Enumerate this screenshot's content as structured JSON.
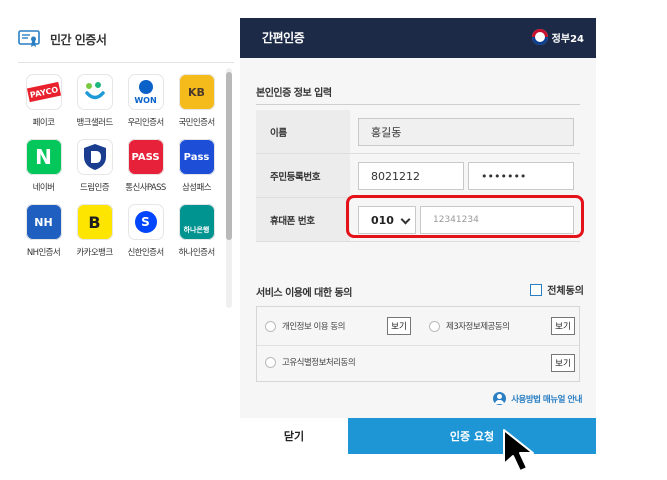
{
  "left_panel": {
    "title": "민간 인증서",
    "apps": [
      {
        "label": "페이코",
        "badge": "PAYCO",
        "bg": "#ffffff",
        "fg": "#ffffff",
        "accent": "#e8212c"
      },
      {
        "label": "뱅크샐러드",
        "badge": "",
        "bg": "#ffffff",
        "fg": "#1fb57f",
        "accent": "#1fb57f"
      },
      {
        "label": "우리인증서",
        "badge": "WON",
        "bg": "#ffffff",
        "fg": "#0a62c9",
        "accent": "#0a62c9"
      },
      {
        "label": "국민인증서",
        "badge": "KB",
        "bg": "#f5bb1a",
        "fg": "#4b3a2b",
        "accent": "#f5bb1a"
      },
      {
        "label": "네이버",
        "badge": "N",
        "bg": "#03c75a",
        "fg": "#ffffff",
        "accent": "#03c75a"
      },
      {
        "label": "드림인증",
        "badge": "D",
        "bg": "#ffffff",
        "fg": "#1a3d8f",
        "accent": "#1a3d8f"
      },
      {
        "label": "통신사PASS",
        "badge": "PASS",
        "bg": "#e8213a",
        "fg": "#ffffff",
        "accent": "#e8213a"
      },
      {
        "label": "삼성패스",
        "badge": "Pass",
        "bg": "#1d4ed8",
        "fg": "#ffffff",
        "accent": "#1d4ed8"
      },
      {
        "label": "NH인증서",
        "badge": "NH",
        "bg": "#1f5fbf",
        "fg": "#ffffff",
        "accent": "#1f5fbf"
      },
      {
        "label": "카카오뱅크",
        "badge": "B",
        "bg": "#fee500",
        "fg": "#1e1e1e",
        "accent": "#fee500"
      },
      {
        "label": "신한인증서",
        "badge": "S",
        "bg": "#ffffff",
        "fg": "#0046ff",
        "accent": "#0046ff"
      },
      {
        "label": "하나인증서",
        "badge": "하나은행",
        "bg": "#009490",
        "fg": "#ffffff",
        "accent": "#009490"
      }
    ]
  },
  "right_panel": {
    "title": "간편인증",
    "gov_brand": "정부24",
    "section_title": "본인인증 정보 입력",
    "name": {
      "label": "이름",
      "value": "홍길동"
    },
    "rrn": {
      "label": "주민등록번호",
      "front": "8021212",
      "back": "•••••••"
    },
    "phone": {
      "label": "휴대폰 번호",
      "carrier": "010",
      "number": "12341234"
    },
    "agree_title": "서비스 이용에 대한 동의",
    "agree_all": "전체동의",
    "agreements": [
      {
        "label": "개인정보 이용 동의",
        "view": "보기"
      },
      {
        "label": "제3자정보제공동의",
        "view": "보기"
      },
      {
        "label": "고유식별정보처리동의",
        "view": "보기"
      }
    ],
    "manual_link": "사용방법 매뉴얼 안내",
    "close_button": "닫기",
    "request_button": "인증 요청"
  }
}
